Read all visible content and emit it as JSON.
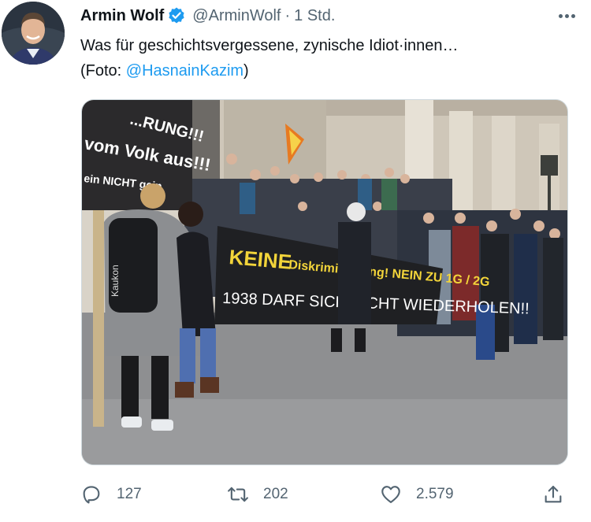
{
  "tweet": {
    "author_name": "Armin Wolf",
    "handle": "@ArminWolf",
    "separator": "·",
    "time": "1 Std.",
    "text_line1": "Was für geschichtsvergessene, zynische Idiot·innen…",
    "text_prefix": "(Foto: ",
    "mention": "@HasnainKazim",
    "text_suffix": ")"
  },
  "photo": {
    "sign_top": "...RUNG!!!",
    "sign_mid": "vom Volk aus!!!",
    "sign_low": "ein NICHT gein",
    "banner_line1_bold": "KEINE",
    "banner_line1_rest": "Diskriminierung! NEIN ZU 1G / 2G",
    "banner_line2": "1938 DARF SICH NICHT WIEDERHOLEN!!",
    "backpack_brand": "Kaukon"
  },
  "actions": {
    "replies": "127",
    "retweets": "202",
    "likes": "2.579"
  },
  "colors": {
    "link": "#1d9bf0",
    "muted": "#536471",
    "banner_yellow": "#f2d43a"
  },
  "icons": [
    "avatar-photo",
    "verified-badge-icon",
    "more-options-icon",
    "reply-icon",
    "retweet-icon",
    "like-icon",
    "share-icon"
  ]
}
